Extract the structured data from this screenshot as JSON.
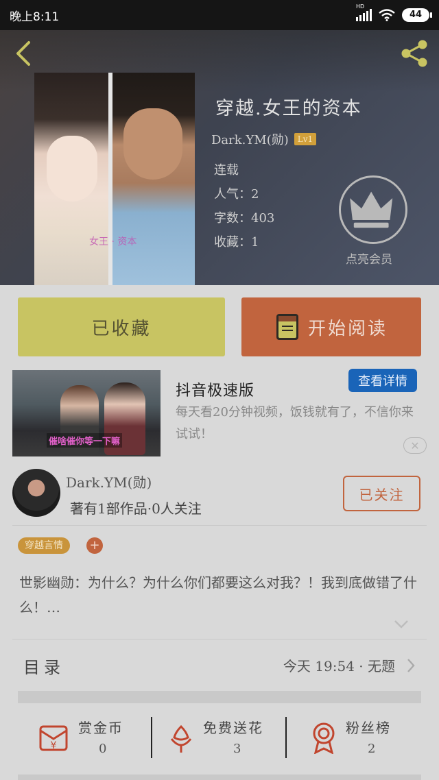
{
  "status_bar": {
    "time": "晚上8:11",
    "battery": "44",
    "network": "HD"
  },
  "book": {
    "title": "穿越.女王的资本",
    "author": "Dark.YM(勋)",
    "level": "Lv1",
    "status": "连载",
    "popularity": "人气：2",
    "word_count": "字数：403",
    "collections": "收藏：1",
    "cover_watermark": "女王 · 资本"
  },
  "vip": {
    "label": "点亮会员"
  },
  "actions": {
    "collected": "已收藏",
    "start_reading": "开始阅读"
  },
  "ad": {
    "title": "抖音极速版",
    "button": "查看详情",
    "description": "每天看20分钟视频，饭钱就有了，不信你来试试！",
    "caption": "催啥催你等一下嘛",
    "close": "✕"
  },
  "author_card": {
    "name": "Dark.YM(勋)",
    "stats": "著有1部作品·0人关注",
    "follow": "已关注"
  },
  "tags": {
    "genre": "穿越言情",
    "add": "+"
  },
  "intro": "世影幽勋：为什么？为什么你们都要这么对我？！我到底做错了什么！…",
  "toc": {
    "label": "目录",
    "latest": "今天 19:54 · 无题"
  },
  "stats": [
    {
      "label": "赏金币",
      "value": "0",
      "icon": "gold-coin-envelope-icon"
    },
    {
      "label": "免费送花",
      "value": "3",
      "icon": "flower-icon"
    },
    {
      "label": "粉丝榜",
      "value": "2",
      "icon": "medal-icon"
    }
  ],
  "colors": {
    "collected_bg": "#c8c462",
    "read_bg": "#c1643e",
    "accent_red": "#c1643e",
    "ad_button": "#1a64b8",
    "tag": "#c9943b"
  }
}
